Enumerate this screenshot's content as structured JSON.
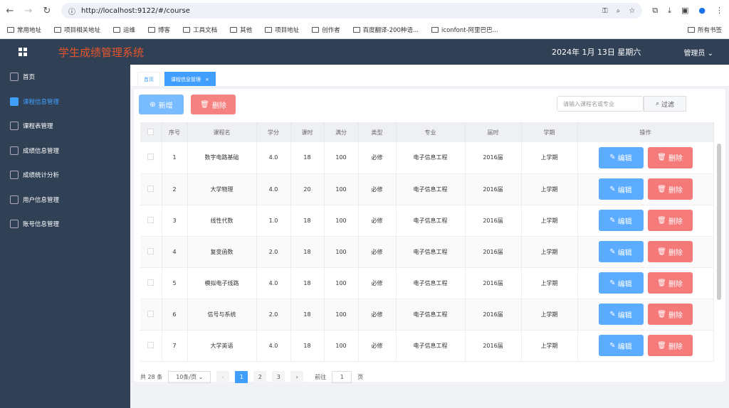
{
  "browser": {
    "url": "http://localhost:9122/#/course",
    "bookmarks": [
      "常用地址",
      "项目相关地址",
      "运维",
      "博客",
      "工具文档",
      "其他",
      "项目地址",
      "创作者",
      "百度翻译-200种语...",
      "iconfont-阿里巴巴..."
    ],
    "all_bookmarks": "所有书签"
  },
  "header": {
    "title": "学生成绩管理系统",
    "date": "2024年 1月 13日   星期六",
    "user": "管理员"
  },
  "sidebar": {
    "items": [
      {
        "label": "首页"
      },
      {
        "label": "课程信息管理",
        "active": true
      },
      {
        "label": "课程表管理"
      },
      {
        "label": "成绩信息管理"
      },
      {
        "label": "成绩统计分析"
      },
      {
        "label": "用户信息管理"
      },
      {
        "label": "账号信息管理"
      }
    ]
  },
  "tabs": [
    {
      "label": "首页"
    },
    {
      "label": "课程信息管理",
      "active": true
    }
  ],
  "toolbar": {
    "add": "新增",
    "delete": "删除",
    "search_placeholder": "请输入课程名或专业",
    "filter": "过滤"
  },
  "table": {
    "columns": [
      "序号",
      "课程名",
      "学分",
      "课时",
      "满分",
      "类型",
      "专业",
      "届时",
      "学期",
      "操作"
    ],
    "rows": [
      [
        "1",
        "数字电路基础",
        "4.0",
        "18",
        "100",
        "必修",
        "电子信息工程",
        "2016届",
        "上学期"
      ],
      [
        "2",
        "大学物理",
        "4.0",
        "20",
        "100",
        "必修",
        "电子信息工程",
        "2016届",
        "上学期"
      ],
      [
        "3",
        "线性代数",
        "1.0",
        "18",
        "100",
        "必修",
        "电子信息工程",
        "2016届",
        "上学期"
      ],
      [
        "4",
        "复变函数",
        "2.0",
        "18",
        "100",
        "必修",
        "电子信息工程",
        "2016届",
        "上学期"
      ],
      [
        "5",
        "模拟电子线路",
        "4.0",
        "18",
        "100",
        "必修",
        "电子信息工程",
        "2016届",
        "上学期"
      ],
      [
        "6",
        "信号与系统",
        "2.0",
        "18",
        "100",
        "必修",
        "电子信息工程",
        "2016届",
        "上学期"
      ],
      [
        "7",
        "大学英语",
        "4.0",
        "18",
        "100",
        "必修",
        "电子信息工程",
        "2016届",
        "上学期"
      ]
    ],
    "edit": "编辑",
    "remove": "删除"
  },
  "pager": {
    "total": "共 28 条",
    "size": "10条/页",
    "pages": [
      "1",
      "2",
      "3"
    ],
    "goto": "前往",
    "goto_value": "1",
    "page_unit": "页"
  },
  "colors": {
    "header": "#304156",
    "primary": "#409eff",
    "danger": "#f56c6c",
    "title": "#e8542a"
  }
}
